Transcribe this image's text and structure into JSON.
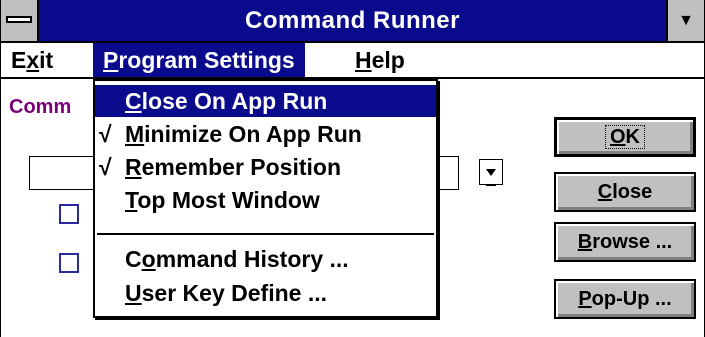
{
  "window": {
    "title": "Command Runner",
    "minimize_glyph": "▼",
    "title_bar_color": "#0a0a8c"
  },
  "menubar": {
    "items": [
      {
        "pre": "E",
        "key": "x",
        "post": "it"
      },
      {
        "pre": "",
        "key": "P",
        "post": "rogram Settings"
      },
      {
        "pre": "",
        "key": "H",
        "post": "elp"
      }
    ]
  },
  "main": {
    "command_label": "Comm",
    "command_value": ""
  },
  "buttons": [
    {
      "pre": "",
      "key": "O",
      "post": "K"
    },
    {
      "pre": "",
      "key": "C",
      "post": "lose"
    },
    {
      "pre": "",
      "key": "B",
      "post": "rowse ..."
    },
    {
      "pre": "",
      "key": "P",
      "post": "op-Up ..."
    }
  ],
  "dropdown": {
    "items": [
      {
        "check": "",
        "pre": "",
        "key": "C",
        "post": "lose On App Run",
        "highlighted": true
      },
      {
        "check": "√",
        "pre": "",
        "key": "M",
        "post": "inimize On App Run"
      },
      {
        "check": "√",
        "pre": "",
        "key": "R",
        "post": "emember Position"
      },
      {
        "check": "",
        "pre": "",
        "key": "T",
        "post": "op Most Window"
      },
      {
        "check": "",
        "pre": "C",
        "key": "o",
        "post": "mmand History ..."
      },
      {
        "check": "",
        "pre": "",
        "key": "U",
        "post": "ser Key Define ..."
      }
    ]
  }
}
